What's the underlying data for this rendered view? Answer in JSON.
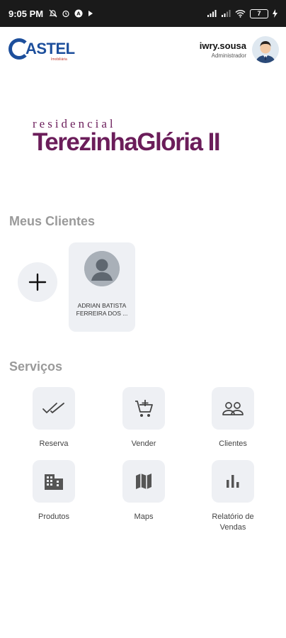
{
  "status_bar": {
    "time": "9:05 PM",
    "battery": "7"
  },
  "header": {
    "logo_text": "ASTEL",
    "logo_sub": "Imobiliária",
    "user_name": "iwry.sousa",
    "user_role": "Administrador"
  },
  "brand": {
    "small": "residencial",
    "big": "TerezinhaGlória II",
    "color": "#6b1d5a"
  },
  "clients_section": {
    "title": "Meus Clientes",
    "add_icon": "plus-icon",
    "clients": [
      {
        "name": "ADRIAN BATISTA FERREIRA DOS ..."
      }
    ]
  },
  "services_section": {
    "title": "Serviços",
    "items": [
      {
        "label": "Reserva",
        "icon": "double-check-icon"
      },
      {
        "label": "Vender",
        "icon": "cart-add-icon"
      },
      {
        "label": "Clientes",
        "icon": "people-icon"
      },
      {
        "label": "Produtos",
        "icon": "building-icon"
      },
      {
        "label": "Maps",
        "icon": "map-icon"
      },
      {
        "label": "Relatório de Vendas",
        "icon": "bar-chart-icon"
      }
    ]
  },
  "colors": {
    "accent": "#1d4f9c",
    "tile_bg": "#eef0f4",
    "section_title": "#9a9a9a"
  }
}
